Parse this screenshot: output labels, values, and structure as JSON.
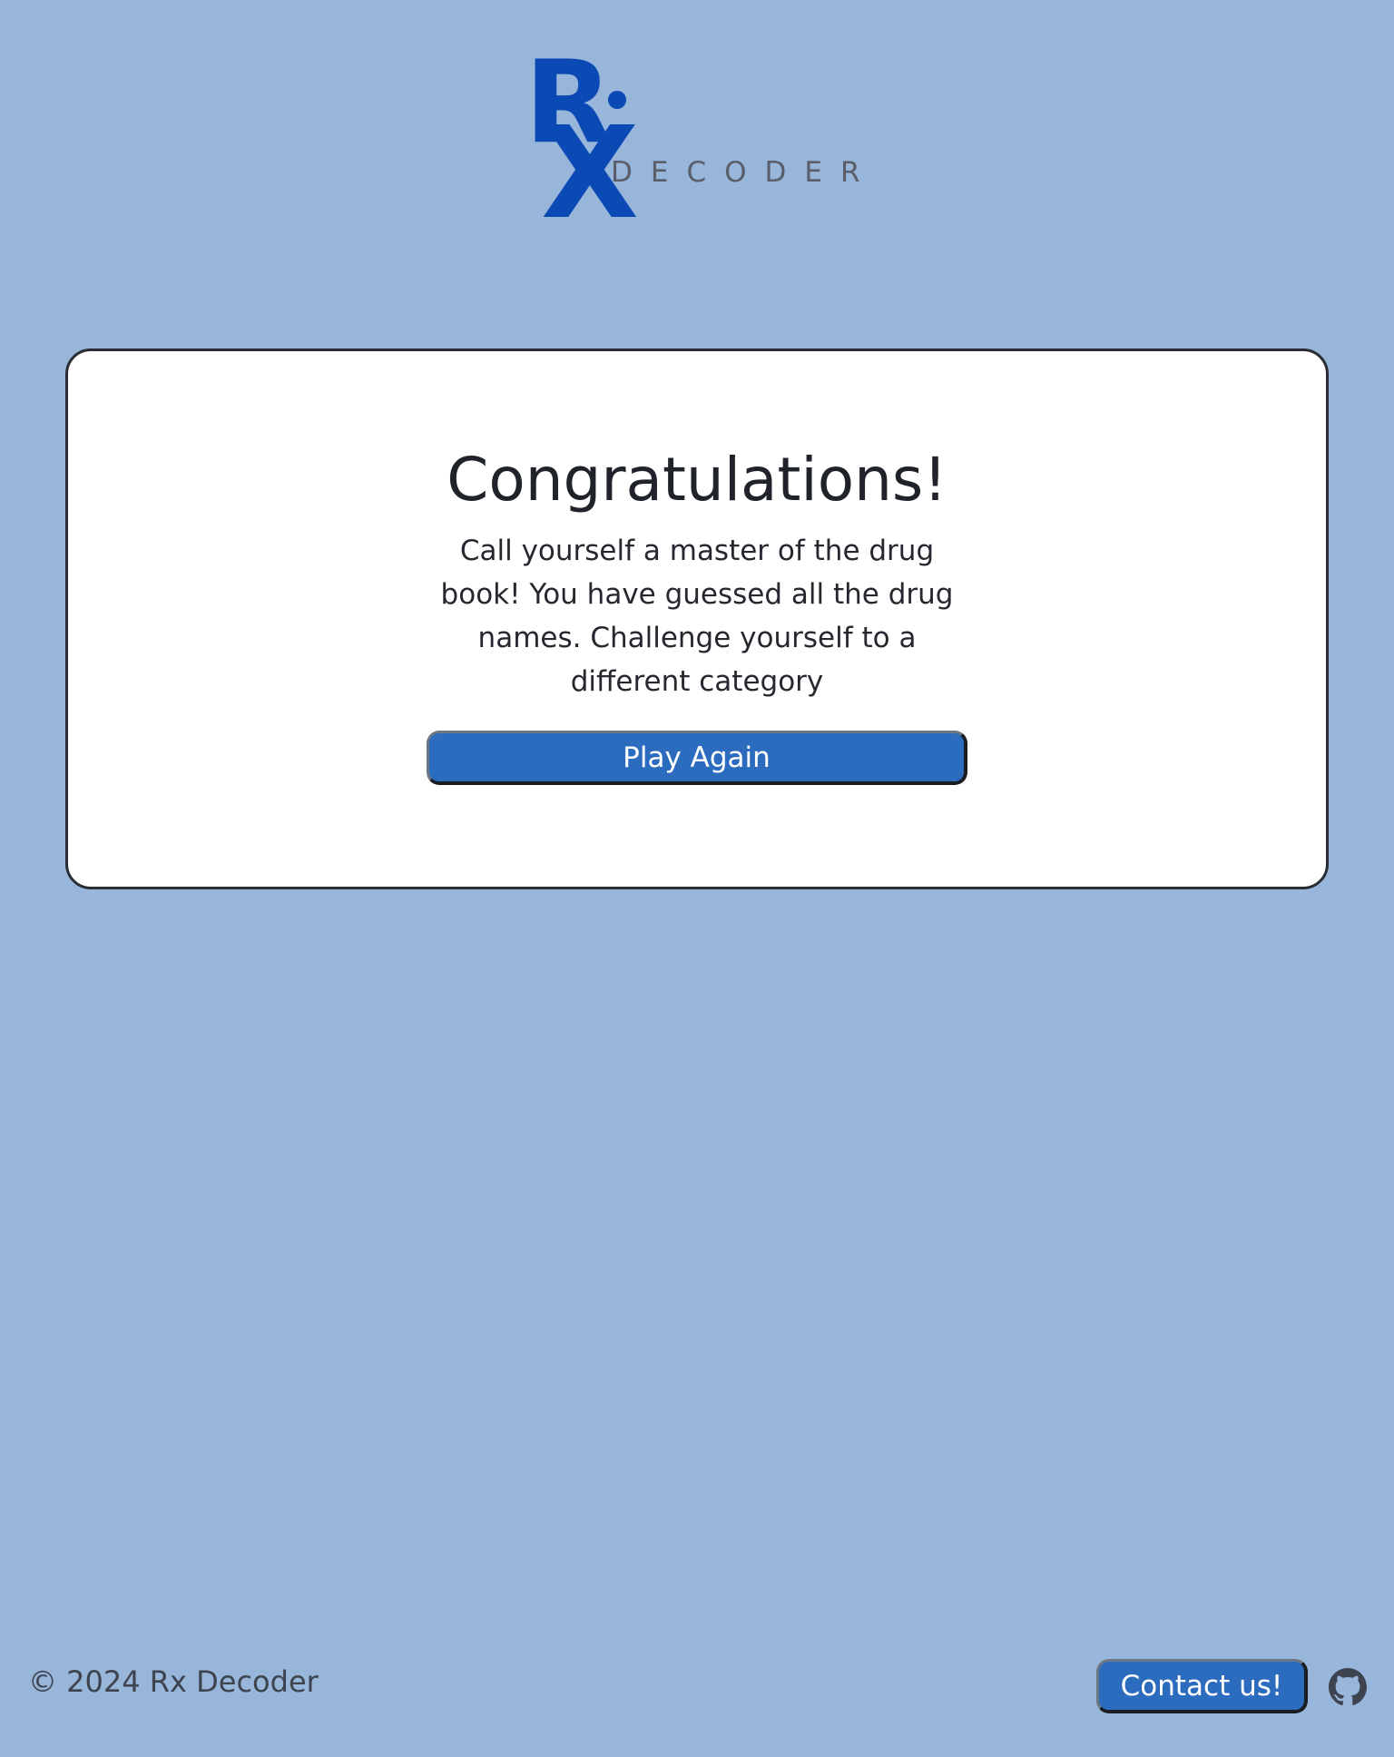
{
  "logo": {
    "mark_r": "R",
    "mark_x": "X",
    "wordmark": "DECODER",
    "brand_color": "#0b49b5",
    "wordmark_color": "#595e6a"
  },
  "card": {
    "title": "Congratulations!",
    "message": "Call yourself a master of the drug book! You have guessed all the drug names. Challenge yourself to a different category",
    "play_again_label": "Play Again"
  },
  "footer": {
    "copyright": "© 2024 Rx Decoder",
    "contact_label": "Contact us!",
    "github_icon": "github-icon"
  },
  "colors": {
    "background": "#98b6da",
    "button": "#2b6cbf",
    "card_border": "#2a2d33"
  }
}
